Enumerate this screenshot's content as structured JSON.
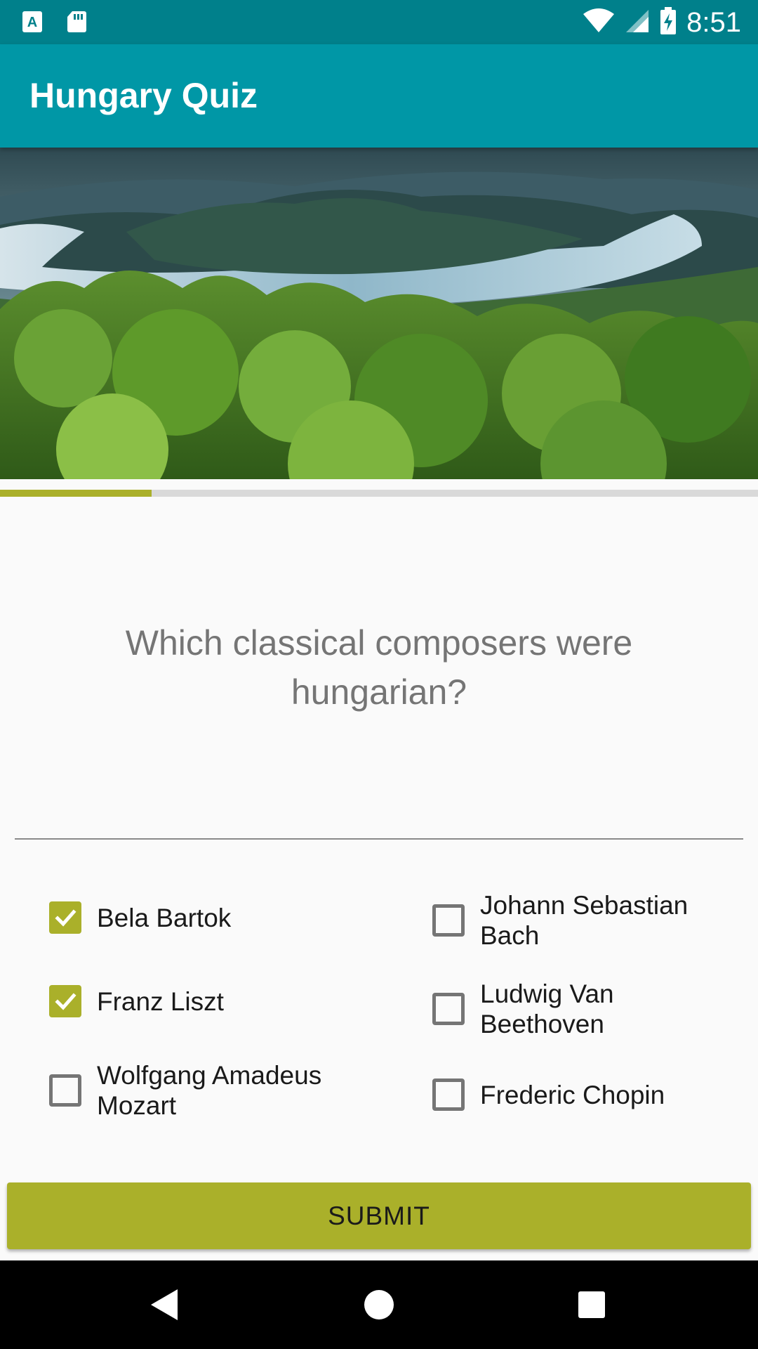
{
  "status_bar": {
    "time": "8:51",
    "icons": [
      "keyboard-a-icon",
      "sd-card-icon",
      "wifi-icon",
      "signal-icon",
      "battery-charging-icon"
    ]
  },
  "app_bar": {
    "title": "Hungary Quiz"
  },
  "hero": {
    "image": "danube-bend-landscape"
  },
  "progress": {
    "value": 0.2
  },
  "question": {
    "text": "Which classical composers were hungarian?"
  },
  "answers": [
    {
      "label": "Bela Bartok",
      "checked": true
    },
    {
      "label": "Johann Sebastian Bach",
      "checked": false
    },
    {
      "label": "Franz Liszt",
      "checked": true
    },
    {
      "label": "Ludwig Van Beethoven",
      "checked": false
    },
    {
      "label": "Wolfgang Amadeus Mozart",
      "checked": false
    },
    {
      "label": "Frederic Chopin",
      "checked": false
    }
  ],
  "submit": {
    "label": "SUBMIT"
  },
  "nav": {
    "buttons": [
      "back-icon",
      "home-icon",
      "recents-icon"
    ]
  },
  "colors": {
    "status_bar": "#00808b",
    "app_bar": "#0097a6",
    "accent": "#aab02a"
  }
}
